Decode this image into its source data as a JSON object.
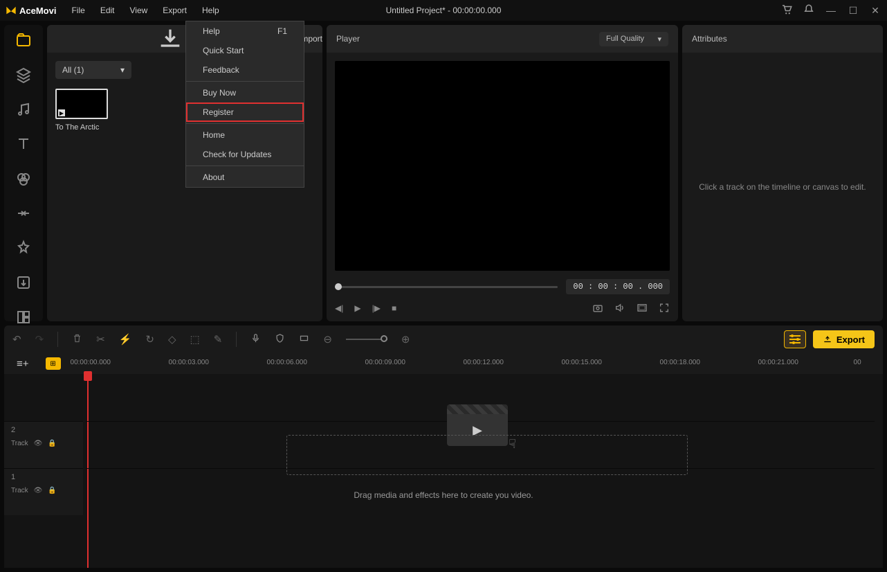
{
  "app": {
    "name": "AceMovi",
    "title": "Untitled Project* - 00:00:00.000"
  },
  "menubar": [
    "File",
    "Edit",
    "View",
    "Export",
    "Help"
  ],
  "helpMenu": {
    "help": "Help",
    "helpShortcut": "F1",
    "quickStart": "Quick Start",
    "feedback": "Feedback",
    "buyNow": "Buy Now",
    "register": "Register",
    "home": "Home",
    "checkUpdates": "Check for Updates",
    "about": "About"
  },
  "mediaPanel": {
    "import": "Import",
    "filter": "All (1)",
    "clip": {
      "name": "To The Arctic"
    }
  },
  "player": {
    "title": "Player",
    "quality": "Full Quality",
    "time": "00 : 00 : 00 . 000"
  },
  "attributes": {
    "title": "Attributes",
    "placeholder": "Click a track on the timeline or canvas to edit."
  },
  "toolbar": {
    "export": "Export"
  },
  "ruler": {
    "ticks": [
      "00:00:00.000",
      "00:00:03.000",
      "00:00:06.000",
      "00:00:09.000",
      "00:00:12.000",
      "00:00:15.000",
      "00:00:18.000",
      "00:00:21.000",
      "00"
    ]
  },
  "tracks": {
    "t1": {
      "num": "1",
      "label": "Track"
    },
    "t2": {
      "num": "2",
      "label": "Track"
    }
  },
  "timeline": {
    "dropHint": "Drag media and effects here to create you video."
  }
}
